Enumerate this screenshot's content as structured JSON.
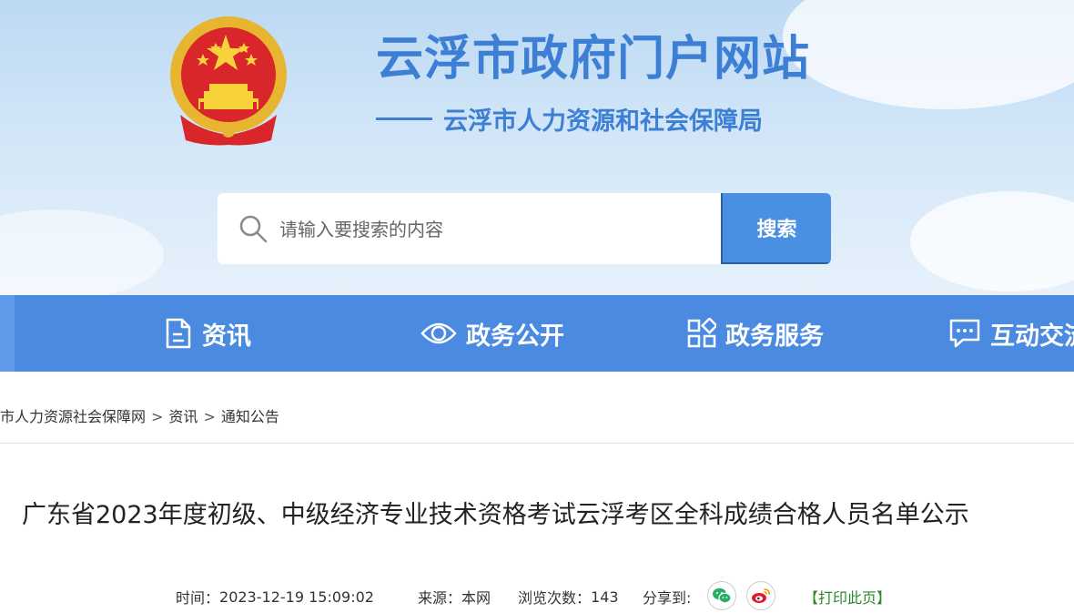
{
  "header": {
    "site_title": "云浮市政府门户网站",
    "department": "云浮市人力资源和社会保障局",
    "emblem_icon": "national-emblem-icon"
  },
  "search": {
    "placeholder": "请输入要搜索的内容",
    "button_label": "搜索",
    "icon": "search-icon"
  },
  "nav": {
    "items": [
      {
        "label": "资讯",
        "icon": "document-icon"
      },
      {
        "label": "政务公开",
        "icon": "eye-icon"
      },
      {
        "label": "政务服务",
        "icon": "grid-icon"
      },
      {
        "label": "互动交流",
        "icon": "chat-icon"
      }
    ]
  },
  "breadcrumb": {
    "items": [
      "云浮市人力资源社会保障网",
      "资讯",
      "通知公告"
    ],
    "separator": ">"
  },
  "article": {
    "title": "广东省2023年度初级、中级经济专业技术资格考试云浮考区全科成绩合格人员名单公示",
    "time_label": "时间：",
    "time_value": "2023-12-19 15:09:02",
    "source_label": "来源：",
    "source_value": "本网",
    "views_label": "浏览次数：",
    "views_value": "143",
    "share_label": "分享到:",
    "share_icons": [
      "wechat-icon",
      "weibo-icon"
    ],
    "print_label": "【打印此页】"
  },
  "colors": {
    "brand_blue": "#3e7fd6",
    "nav_blue": "#4a8ae0",
    "search_button": "#4a90e2",
    "wechat_green": "#2aae67",
    "weibo_red": "#e6162d",
    "print_green": "#2a8a2a"
  }
}
